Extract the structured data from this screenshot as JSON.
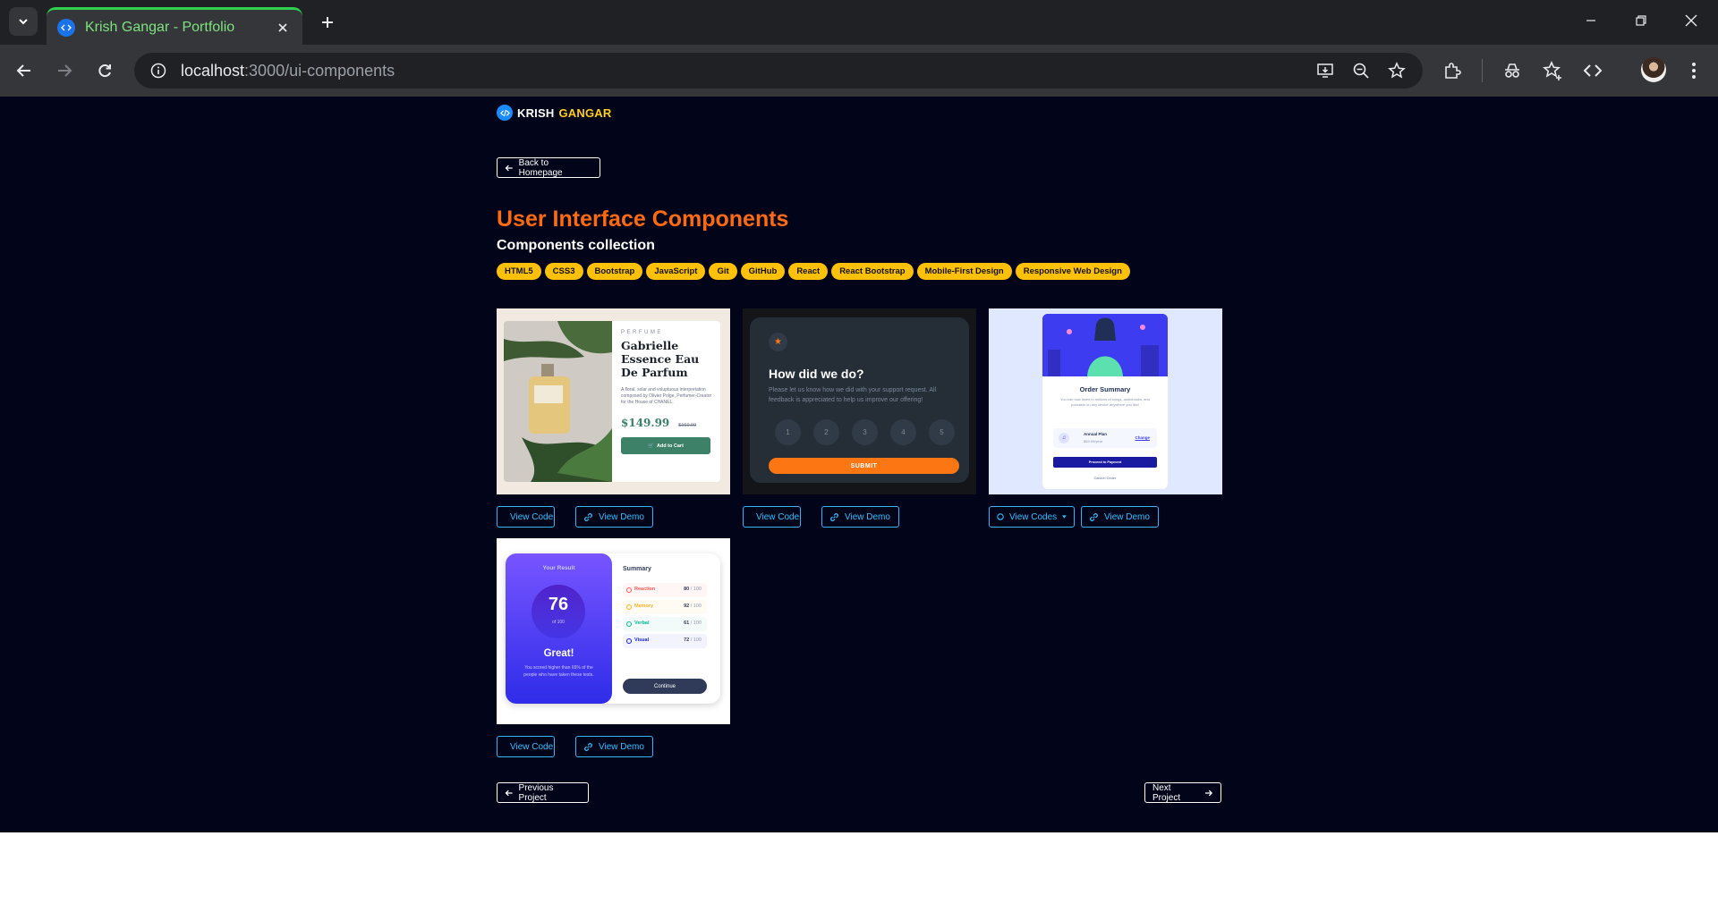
{
  "browser": {
    "tab_title": "Krish Gangar - Portfolio",
    "url_host": "localhost",
    "url_path": ":3000/ui-components"
  },
  "brand": {
    "first": "KRISH",
    "second": "GANGAR"
  },
  "back_label": "Back to Homepage",
  "title": "User Interface Components",
  "subtitle": "Components collection",
  "tags": [
    "HTML5",
    "CSS3",
    "Bootstrap",
    "JavaScript",
    "Git",
    "GitHub",
    "React",
    "React Bootstrap",
    "Mobile-First Design",
    "Responsive Web Design"
  ],
  "cards": [
    {
      "code_label": "View Code",
      "demo_label": "View Demo"
    },
    {
      "code_label": "View Code",
      "demo_label": "View Demo"
    },
    {
      "code_label": "View Codes",
      "demo_label": "View Demo"
    },
    {
      "code_label": "View Code",
      "demo_label": "View Demo"
    }
  ],
  "perfume": {
    "kicker": "PERFUME",
    "name": "Gabrielle Essence Eau De Parfum",
    "desc": "A floral, solar and voluptuous interpretation composed by Olivier Polge, Perfumer-Creator for the House of CHANEL.",
    "price": "$149.99",
    "old_price": "$169.99",
    "button": "Add to Cart"
  },
  "rating": {
    "question": "How did we do?",
    "desc": "Please let us know how we did with your support request. All feedback is appreciated to help us improve our offering!",
    "numbers": [
      "1",
      "2",
      "3",
      "4",
      "5"
    ],
    "submit": "SUBMIT"
  },
  "order": {
    "title": "Order Summary",
    "desc": "You can now listen to millions of songs, audiobooks, and podcasts on any device anywhere you like!",
    "plan_name": "Annual Plan",
    "plan_price": "$59.99/year",
    "change": "Change",
    "pay": "Proceed to Payment",
    "cancel": "Cancel Order"
  },
  "results": {
    "your_result": "Your Result",
    "score": "76",
    "of": "of 100",
    "great": "Great!",
    "note": "You scored higher than 65% of the people who have taken these tests.",
    "summary": "Summary",
    "rows": [
      {
        "label": "Reaction",
        "score": "80",
        "max": " / 100",
        "color": "#ff5757",
        "bg": "#fff6f5"
      },
      {
        "label": "Memory",
        "score": "92",
        "max": " / 100",
        "color": "#ffb01f",
        "bg": "#fffbf3"
      },
      {
        "label": "Verbal",
        "score": "61",
        "max": " / 100",
        "color": "#00bb8f",
        "bg": "#f2fbfa"
      },
      {
        "label": "Visual",
        "score": "72",
        "max": " / 100",
        "color": "#1125d6",
        "bg": "#f3f3fd"
      }
    ],
    "continue": "Continue"
  },
  "prev_label": "Previous Project",
  "next_label": "Next Project",
  "colors": {
    "page_bg": "#02041a",
    "title": "#ff6a13",
    "tag_bg": "#ffc107",
    "link": "#33c0ff",
    "brand_accent": "#ffcf1a"
  }
}
